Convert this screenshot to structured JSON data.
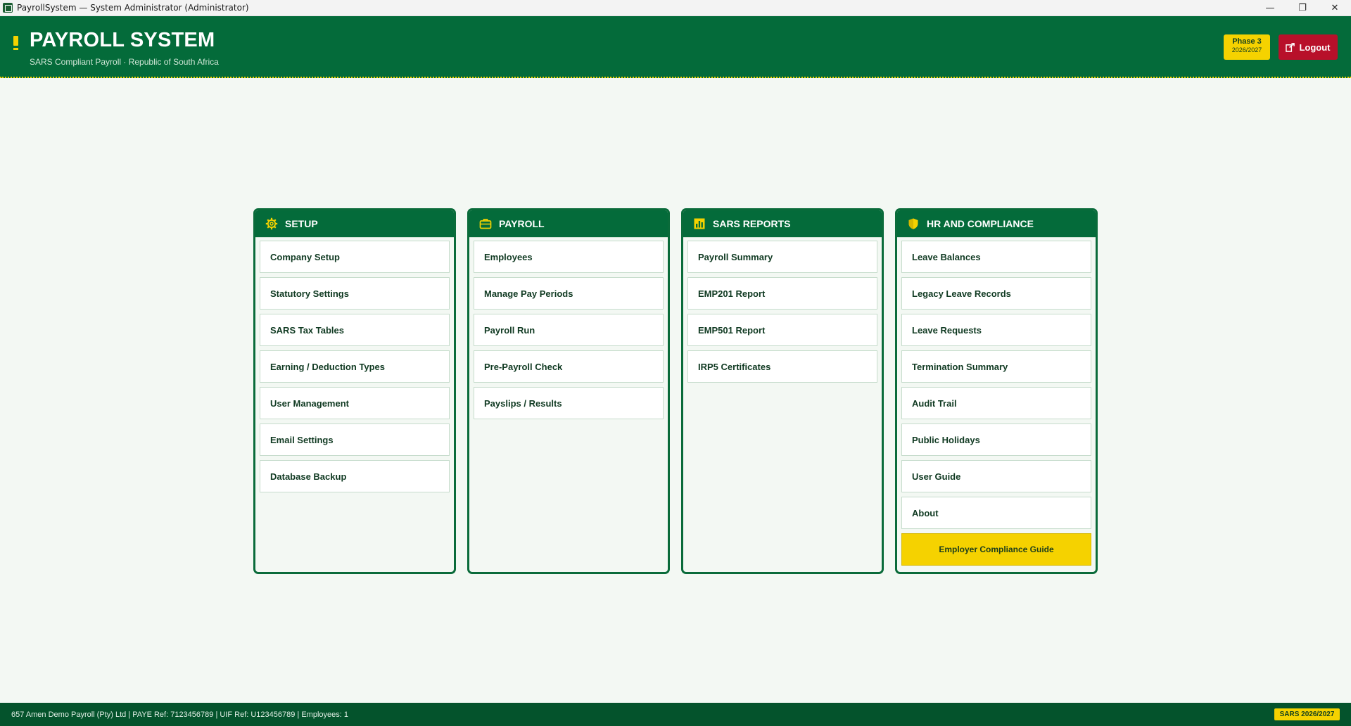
{
  "window": {
    "title": "PayrollSystem — System Administrator (Administrator)",
    "minimize": "—",
    "restore": "❐",
    "close": "✕"
  },
  "header": {
    "title": "PAYROLL SYSTEM",
    "subtitle": "SARS Compliant Payroll · Republic of South Africa",
    "phase_label": "Phase 3",
    "phase_year": "2026/2027",
    "logout_label": "Logout"
  },
  "colors": {
    "brand_green": "#046b3a",
    "accent_yellow": "#f5d200",
    "logout_red": "#b8102a",
    "background": "#f3f8f3"
  },
  "cards": [
    {
      "label": "SETUP",
      "icon": "gear-icon",
      "items": [
        "Company Setup",
        "Statutory Settings",
        "SARS Tax Tables",
        "Earning / Deduction Types",
        "User Management",
        "Email Settings",
        "Database Backup"
      ]
    },
    {
      "label": "PAYROLL",
      "icon": "briefcase-icon",
      "items": [
        "Employees",
        "Manage Pay Periods",
        "Payroll Run",
        "Pre-Payroll Check",
        "Payslips / Results"
      ]
    },
    {
      "label": "SARS REPORTS",
      "icon": "bar-chart-icon",
      "items": [
        "Payroll Summary",
        "EMP201 Report",
        "EMP501 Report",
        "IRP5 Certificates"
      ]
    },
    {
      "label": "HR AND COMPLIANCE",
      "icon": "shield-icon",
      "items": [
        "Leave Balances",
        "Legacy Leave Records",
        "Leave Requests",
        "Termination Summary",
        "Audit Trail",
        "Public Holidays",
        "User Guide",
        "About"
      ],
      "highlight_item": "Employer Compliance Guide"
    }
  ],
  "statusbar": {
    "text": "657 Amen Demo Payroll (Pty) Ltd  |  PAYE Ref: 7123456789  |  UIF Ref: U123456789  |  Employees: 1",
    "badge": "SARS 2026/2027"
  }
}
